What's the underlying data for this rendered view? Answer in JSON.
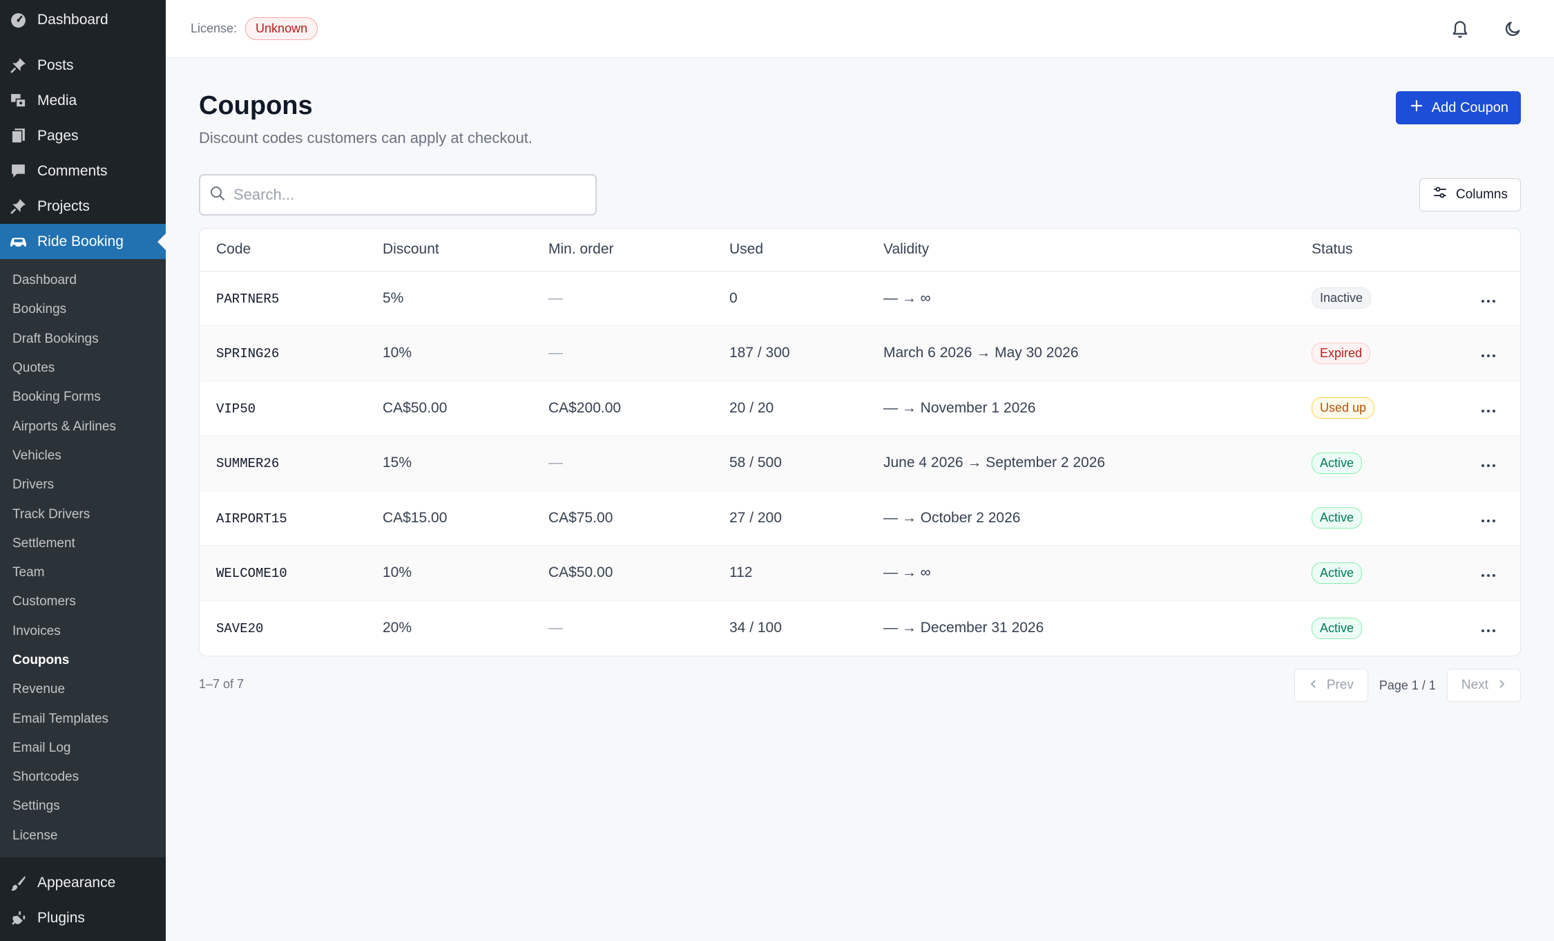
{
  "sidebar": {
    "dashboard": {
      "label": "Dashboard",
      "icon": "dashboard-icon"
    },
    "top_items": [
      {
        "label": "Posts",
        "icon": "pin-icon"
      },
      {
        "label": "Media",
        "icon": "media-icon"
      },
      {
        "label": "Pages",
        "icon": "pages-icon"
      },
      {
        "label": "Comments",
        "icon": "comments-icon"
      },
      {
        "label": "Projects",
        "icon": "pin-icon"
      }
    ],
    "active_item": {
      "label": "Ride Booking",
      "icon": "car-icon"
    },
    "submenu": [
      "Dashboard",
      "Bookings",
      "Draft Bookings",
      "Quotes",
      "Booking Forms",
      "Airports & Airlines",
      "Vehicles",
      "Drivers",
      "Track Drivers",
      "Settlement",
      "Team",
      "Customers",
      "Invoices",
      "Coupons",
      "Revenue",
      "Email Templates",
      "Email Log",
      "Shortcodes",
      "Settings",
      "License"
    ],
    "current_submenu": "Coupons",
    "bottom_items": [
      {
        "label": "Appearance",
        "icon": "brush-icon"
      },
      {
        "label": "Plugins",
        "icon": "plugin-icon"
      }
    ]
  },
  "topbar": {
    "license_label": "License:",
    "license_value": "Unknown"
  },
  "page": {
    "title": "Coupons",
    "subtitle": "Discount codes customers can apply at checkout.",
    "add_button": "Add Coupon",
    "search_placeholder": "Search...",
    "columns_button": "Columns"
  },
  "table": {
    "headers": {
      "code": "Code",
      "discount": "Discount",
      "min_order": "Min. order",
      "used": "Used",
      "validity": "Validity",
      "status": "Status"
    },
    "rows": [
      {
        "code": "PARTNER5",
        "discount": "5%",
        "min_order": "—",
        "used": "0",
        "validity": "— → ∞",
        "status": "Inactive",
        "status_kind": "inactive"
      },
      {
        "code": "SPRING26",
        "discount": "10%",
        "min_order": "—",
        "used": "187 / 300",
        "validity": "March 6 2026 → May 30 2026",
        "status": "Expired",
        "status_kind": "expired"
      },
      {
        "code": "VIP50",
        "discount": "CA$50.00",
        "min_order": "CA$200.00",
        "used": "20 / 20",
        "validity": "— → November 1 2026",
        "status": "Used up",
        "status_kind": "usedup"
      },
      {
        "code": "SUMMER26",
        "discount": "15%",
        "min_order": "—",
        "used": "58 / 500",
        "validity": "June 4 2026 → September 2 2026",
        "status": "Active",
        "status_kind": "active"
      },
      {
        "code": "AIRPORT15",
        "discount": "CA$15.00",
        "min_order": "CA$75.00",
        "used": "27 / 200",
        "validity": "— → October 2 2026",
        "status": "Active",
        "status_kind": "active"
      },
      {
        "code": "WELCOME10",
        "discount": "10%",
        "min_order": "CA$50.00",
        "used": "112",
        "validity": "— → ∞",
        "status": "Active",
        "status_kind": "active"
      },
      {
        "code": "SAVE20",
        "discount": "20%",
        "min_order": "—",
        "used": "34 / 100",
        "validity": "— → December 31 2026",
        "status": "Active",
        "status_kind": "active"
      }
    ]
  },
  "footer": {
    "count": "1–7 of 7",
    "prev": "Prev",
    "page_indicator": "Page 1 / 1",
    "next": "Next"
  },
  "colors": {
    "sidebar_bg": "#1d2327",
    "active_blue": "#2271b1",
    "primary_button": "#1d4ed8"
  }
}
